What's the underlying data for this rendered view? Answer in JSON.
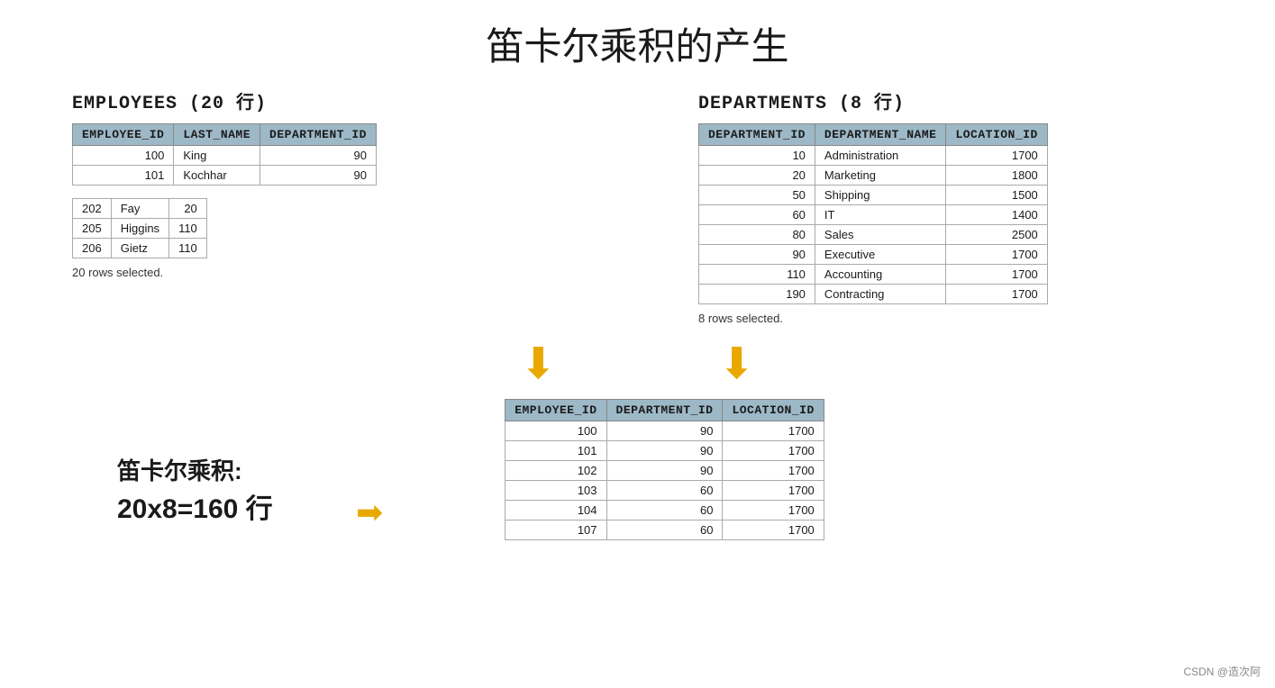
{
  "page": {
    "title": "笛卡尔乘积的产生"
  },
  "employees_table": {
    "section_title": "EMPLOYEES",
    "count_label": "20",
    "count_suffix": " 行）",
    "count_prefix": "（",
    "full_label": "EMPLOYEES (20 行)",
    "headers": [
      "EMPLOYEE_ID",
      "LAST_NAME",
      "DEPARTMENT_ID"
    ],
    "group1": [
      {
        "employee_id": "100",
        "last_name": "King",
        "department_id": "90"
      },
      {
        "employee_id": "101",
        "last_name": "Kochhar",
        "department_id": "90"
      }
    ],
    "group2": [
      {
        "employee_id": "202",
        "last_name": "Fay",
        "department_id": "20"
      },
      {
        "employee_id": "205",
        "last_name": "Higgins",
        "department_id": "110"
      },
      {
        "employee_id": "206",
        "last_name": "Gietz",
        "department_id": "110"
      }
    ],
    "rows_note": "20 rows selected."
  },
  "departments_table": {
    "full_label": "DEPARTMENTS (8 行)",
    "headers": [
      "DEPARTMENT_ID",
      "DEPARTMENT_NAME",
      "LOCATION_ID"
    ],
    "rows": [
      {
        "department_id": "10",
        "department_name": "Administration",
        "location_id": "1700"
      },
      {
        "department_id": "20",
        "department_name": "Marketing",
        "location_id": "1800"
      },
      {
        "department_id": "50",
        "department_name": "Shipping",
        "location_id": "1500"
      },
      {
        "department_id": "60",
        "department_name": "IT",
        "location_id": "1400"
      },
      {
        "department_id": "80",
        "department_name": "Sales",
        "location_id": "2500"
      },
      {
        "department_id": "90",
        "department_name": "Executive",
        "location_id": "1700"
      },
      {
        "department_id": "110",
        "department_name": "Accounting",
        "location_id": "1700"
      },
      {
        "department_id": "190",
        "department_name": "Contracting",
        "location_id": "1700"
      }
    ],
    "rows_note": "8 rows selected."
  },
  "result_table": {
    "headers": [
      "EMPLOYEE_ID",
      "DEPARTMENT_ID",
      "LOCATION_ID"
    ],
    "rows": [
      {
        "employee_id": "100",
        "department_id": "90",
        "location_id": "1700"
      },
      {
        "employee_id": "101",
        "department_id": "90",
        "location_id": "1700"
      },
      {
        "employee_id": "102",
        "department_id": "90",
        "location_id": "1700"
      },
      {
        "employee_id": "103",
        "department_id": "60",
        "location_id": "1700"
      },
      {
        "employee_id": "104",
        "department_id": "60",
        "location_id": "1700"
      },
      {
        "employee_id": "107",
        "department_id": "60",
        "location_id": "1700"
      }
    ]
  },
  "cartesian": {
    "label_line1": "笛卡尔乘积:",
    "label_line2": "20x8=160 行"
  },
  "watermark": "CSDN @造次阿"
}
